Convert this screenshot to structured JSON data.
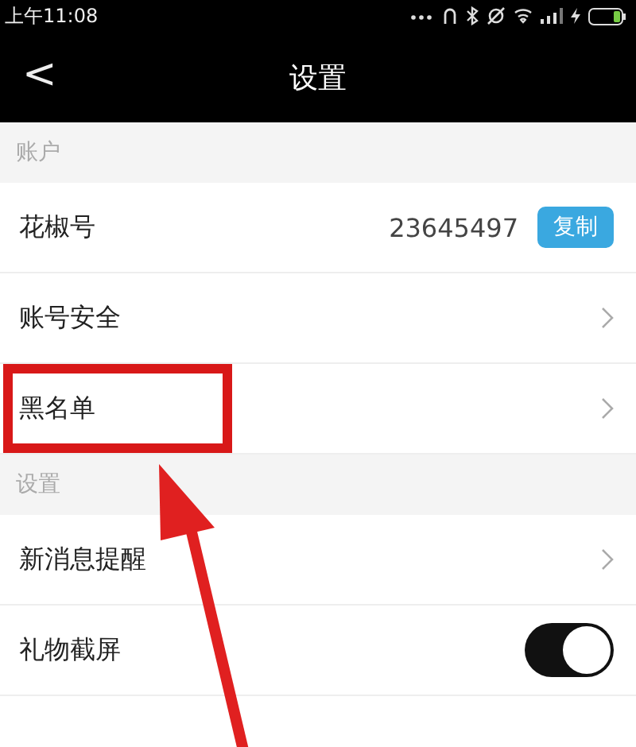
{
  "status_bar": {
    "time": "上午11:08"
  },
  "header": {
    "back": "<",
    "title": "设置"
  },
  "sections": [
    {
      "title": "账户",
      "rows": [
        {
          "kind": "value",
          "label": "花椒号",
          "value": "23645497",
          "button": "复制",
          "highlighted": false
        },
        {
          "kind": "link",
          "label": "账号安全",
          "highlighted": false
        },
        {
          "kind": "link",
          "label": "黑名单",
          "highlighted": true
        }
      ]
    },
    {
      "title": "设置",
      "rows": [
        {
          "kind": "link",
          "label": "新消息提醒",
          "highlighted": false
        },
        {
          "kind": "toggle",
          "label": "礼物截屏",
          "on": true,
          "highlighted": false
        }
      ]
    }
  ]
}
